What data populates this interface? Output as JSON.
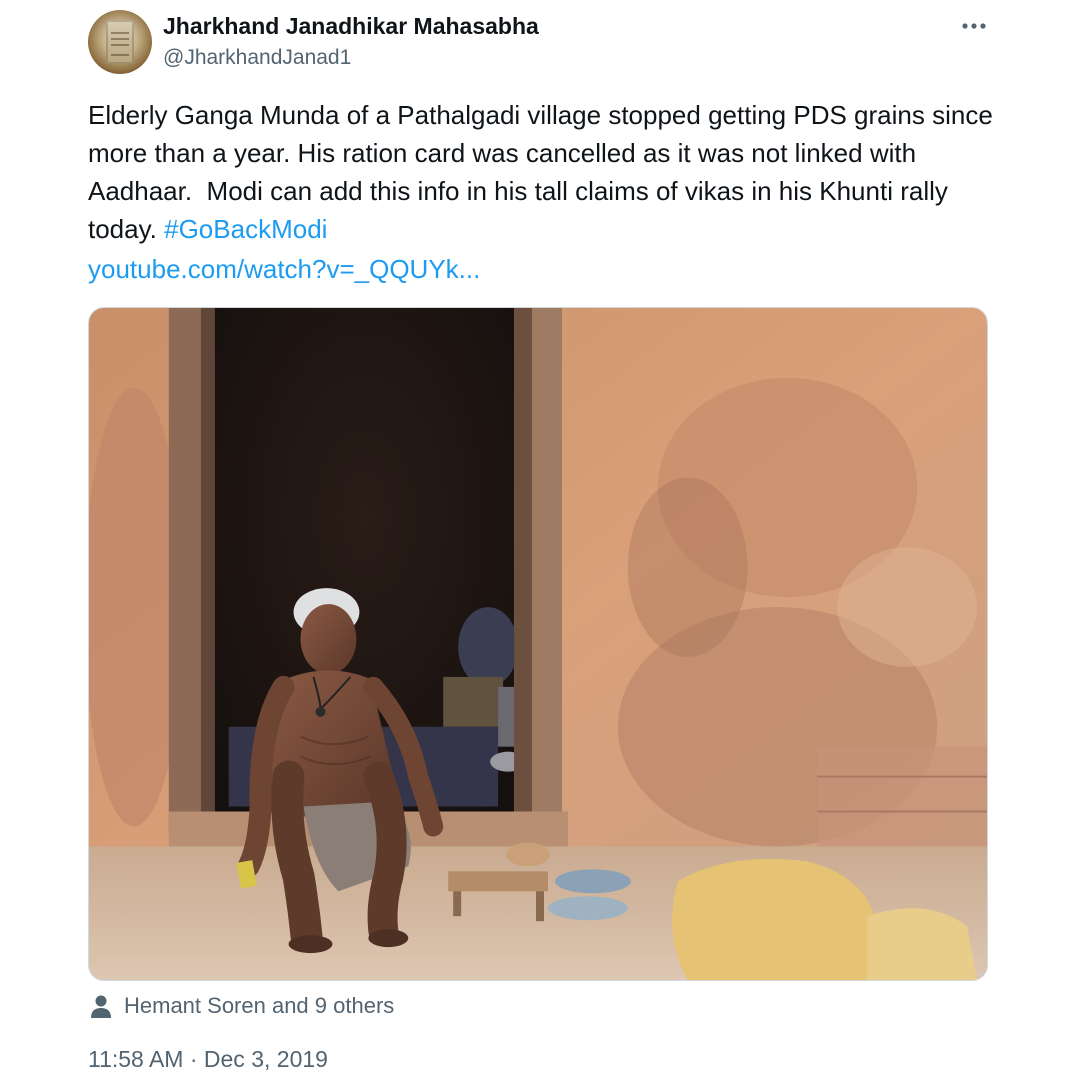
{
  "author": {
    "display_name": "Jharkhand Janadhikar Mahasabha",
    "handle": "@JharkhandJanad1"
  },
  "icons": {
    "more": "more-horizontal-icon",
    "likers": "person-icon"
  },
  "tweet": {
    "text": "Elderly Ganga Munda of a Pathalgadi village stopped getting PDS grains since more than a year. His ration card was cancelled as it was not linked with Aadhaar.  Modi can add this info in his tall claims of vikas in his Khunti rally today. ",
    "hashtag": "#GoBackModi",
    "link": "youtube.com/watch?v=_QQUYk..."
  },
  "engagement": {
    "likers_text": "Hemant Soren and 9 others"
  },
  "meta": {
    "timestamp": "11:58 AM · Dec 3, 2019"
  },
  "colors": {
    "link": "#1d9bf0",
    "secondary_text": "#536471",
    "primary_text": "#0f1419",
    "media_border": "#cfd9de"
  }
}
